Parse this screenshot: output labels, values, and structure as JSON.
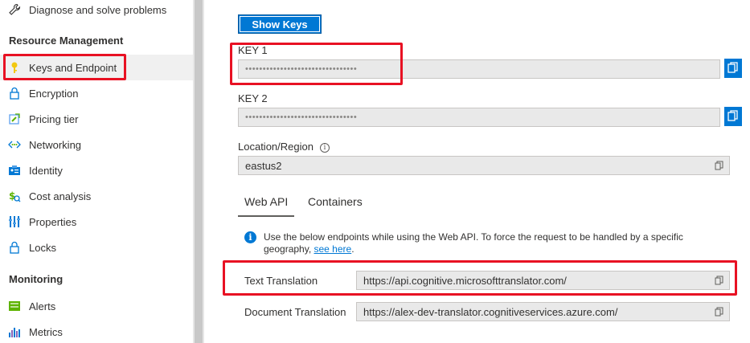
{
  "sidebar": {
    "items": [
      {
        "label": "Diagnose and solve problems",
        "icon": "wrench-icon"
      },
      {
        "label": "Keys and Endpoint",
        "icon": "key-icon"
      },
      {
        "label": "Encryption",
        "icon": "lock-icon"
      },
      {
        "label": "Pricing tier",
        "icon": "pricing-tier-icon"
      },
      {
        "label": "Networking",
        "icon": "networking-icon"
      },
      {
        "label": "Identity",
        "icon": "identity-icon"
      },
      {
        "label": "Cost analysis",
        "icon": "cost-analysis-icon"
      },
      {
        "label": "Properties",
        "icon": "properties-icon"
      },
      {
        "label": "Locks",
        "icon": "lock-icon"
      },
      {
        "label": "Alerts",
        "icon": "alerts-icon"
      },
      {
        "label": "Metrics",
        "icon": "metrics-icon"
      }
    ],
    "sections": {
      "resource_management": "Resource Management",
      "monitoring": "Monitoring"
    },
    "selected": "Keys and Endpoint"
  },
  "main": {
    "show_keys_label": "Show Keys",
    "key1": {
      "label": "KEY 1",
      "value": "••••••••••••••••••••••••••••••••"
    },
    "key2": {
      "label": "KEY 2",
      "value": "••••••••••••••••••••••••••••••••"
    },
    "location": {
      "label": "Location/Region",
      "value": "eastus2"
    },
    "tabs": [
      {
        "label": "Web API",
        "active": true
      },
      {
        "label": "Containers",
        "active": false
      }
    ],
    "info": {
      "text": "Use the below endpoints while using the Web API. To force the request to be handled by a specific geography,",
      "link": "see here",
      "after": "."
    },
    "endpoints": {
      "text_translation": {
        "label": "Text Translation",
        "value": "https://api.cognitive.microsofttranslator.com/"
      },
      "document_translation": {
        "label": "Document Translation",
        "value": "https://alex-dev-translator.cognitiveservices.azure.com/"
      }
    }
  },
  "colors": {
    "accent": "#0078d4",
    "highlight": "#e81123"
  }
}
